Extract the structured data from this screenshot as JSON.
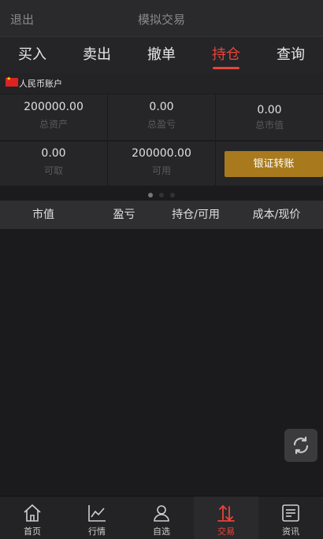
{
  "header": {
    "back_label": "退出",
    "title": "模拟交易"
  },
  "tabs": [
    {
      "label": "买入"
    },
    {
      "label": "卖出"
    },
    {
      "label": "撤单"
    },
    {
      "label": "持仓",
      "active": true
    },
    {
      "label": "查询"
    }
  ],
  "account": {
    "name": "人民币账户",
    "flag_icon": "china-flag-icon"
  },
  "summary": {
    "total_assets": {
      "value": "200000.00",
      "label": "总资产"
    },
    "total_pnl": {
      "value": "0.00",
      "label": "总盈亏"
    },
    "total_market_value": {
      "value": "0.00",
      "label": "总市值"
    },
    "withdrawable": {
      "value": "0.00",
      "label": "可取"
    },
    "available": {
      "value": "200000.00",
      "label": "可用"
    },
    "transfer_button": "银证转账"
  },
  "pager": {
    "count": 3,
    "active_index": 0
  },
  "table": {
    "columns": [
      "市值",
      "盈亏",
      "持仓/可用",
      "成本/现价"
    ],
    "rows": []
  },
  "refresh_icon": "refresh-icon",
  "bottom_nav": [
    {
      "label": "首页",
      "icon": "home-icon"
    },
    {
      "label": "行情",
      "icon": "chart-icon"
    },
    {
      "label": "自选",
      "icon": "user-icon"
    },
    {
      "label": "交易",
      "icon": "trade-icon",
      "active": true
    },
    {
      "label": "资讯",
      "icon": "news-icon"
    }
  ],
  "colors": {
    "accent": "#e8443a",
    "button_gold": "#a97a1d",
    "background": "#1b1b1d"
  }
}
